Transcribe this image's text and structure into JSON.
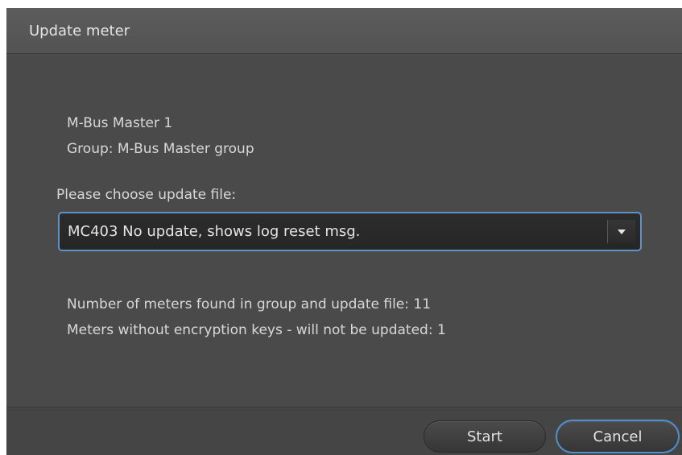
{
  "dialog": {
    "title": "Update meter",
    "device_name": "M-Bus Master 1",
    "group_line": "Group: M-Bus Master group",
    "choose_label": "Please choose update file:",
    "update_file": {
      "selected": "MC403 No update, shows log reset msg.",
      "arrow_icon": "chevron-down-icon"
    },
    "meters_found_line": "Number of meters found in group and update file: 11",
    "meters_without_keys_line": "Meters without encryption keys - will not be updated: 1",
    "buttons": {
      "start_label": "Start",
      "cancel_label": "Cancel"
    }
  },
  "colors": {
    "dialog_bg": "#4a4a4a",
    "focus_accent": "#5d93c7",
    "text": "#d8d8d8"
  }
}
